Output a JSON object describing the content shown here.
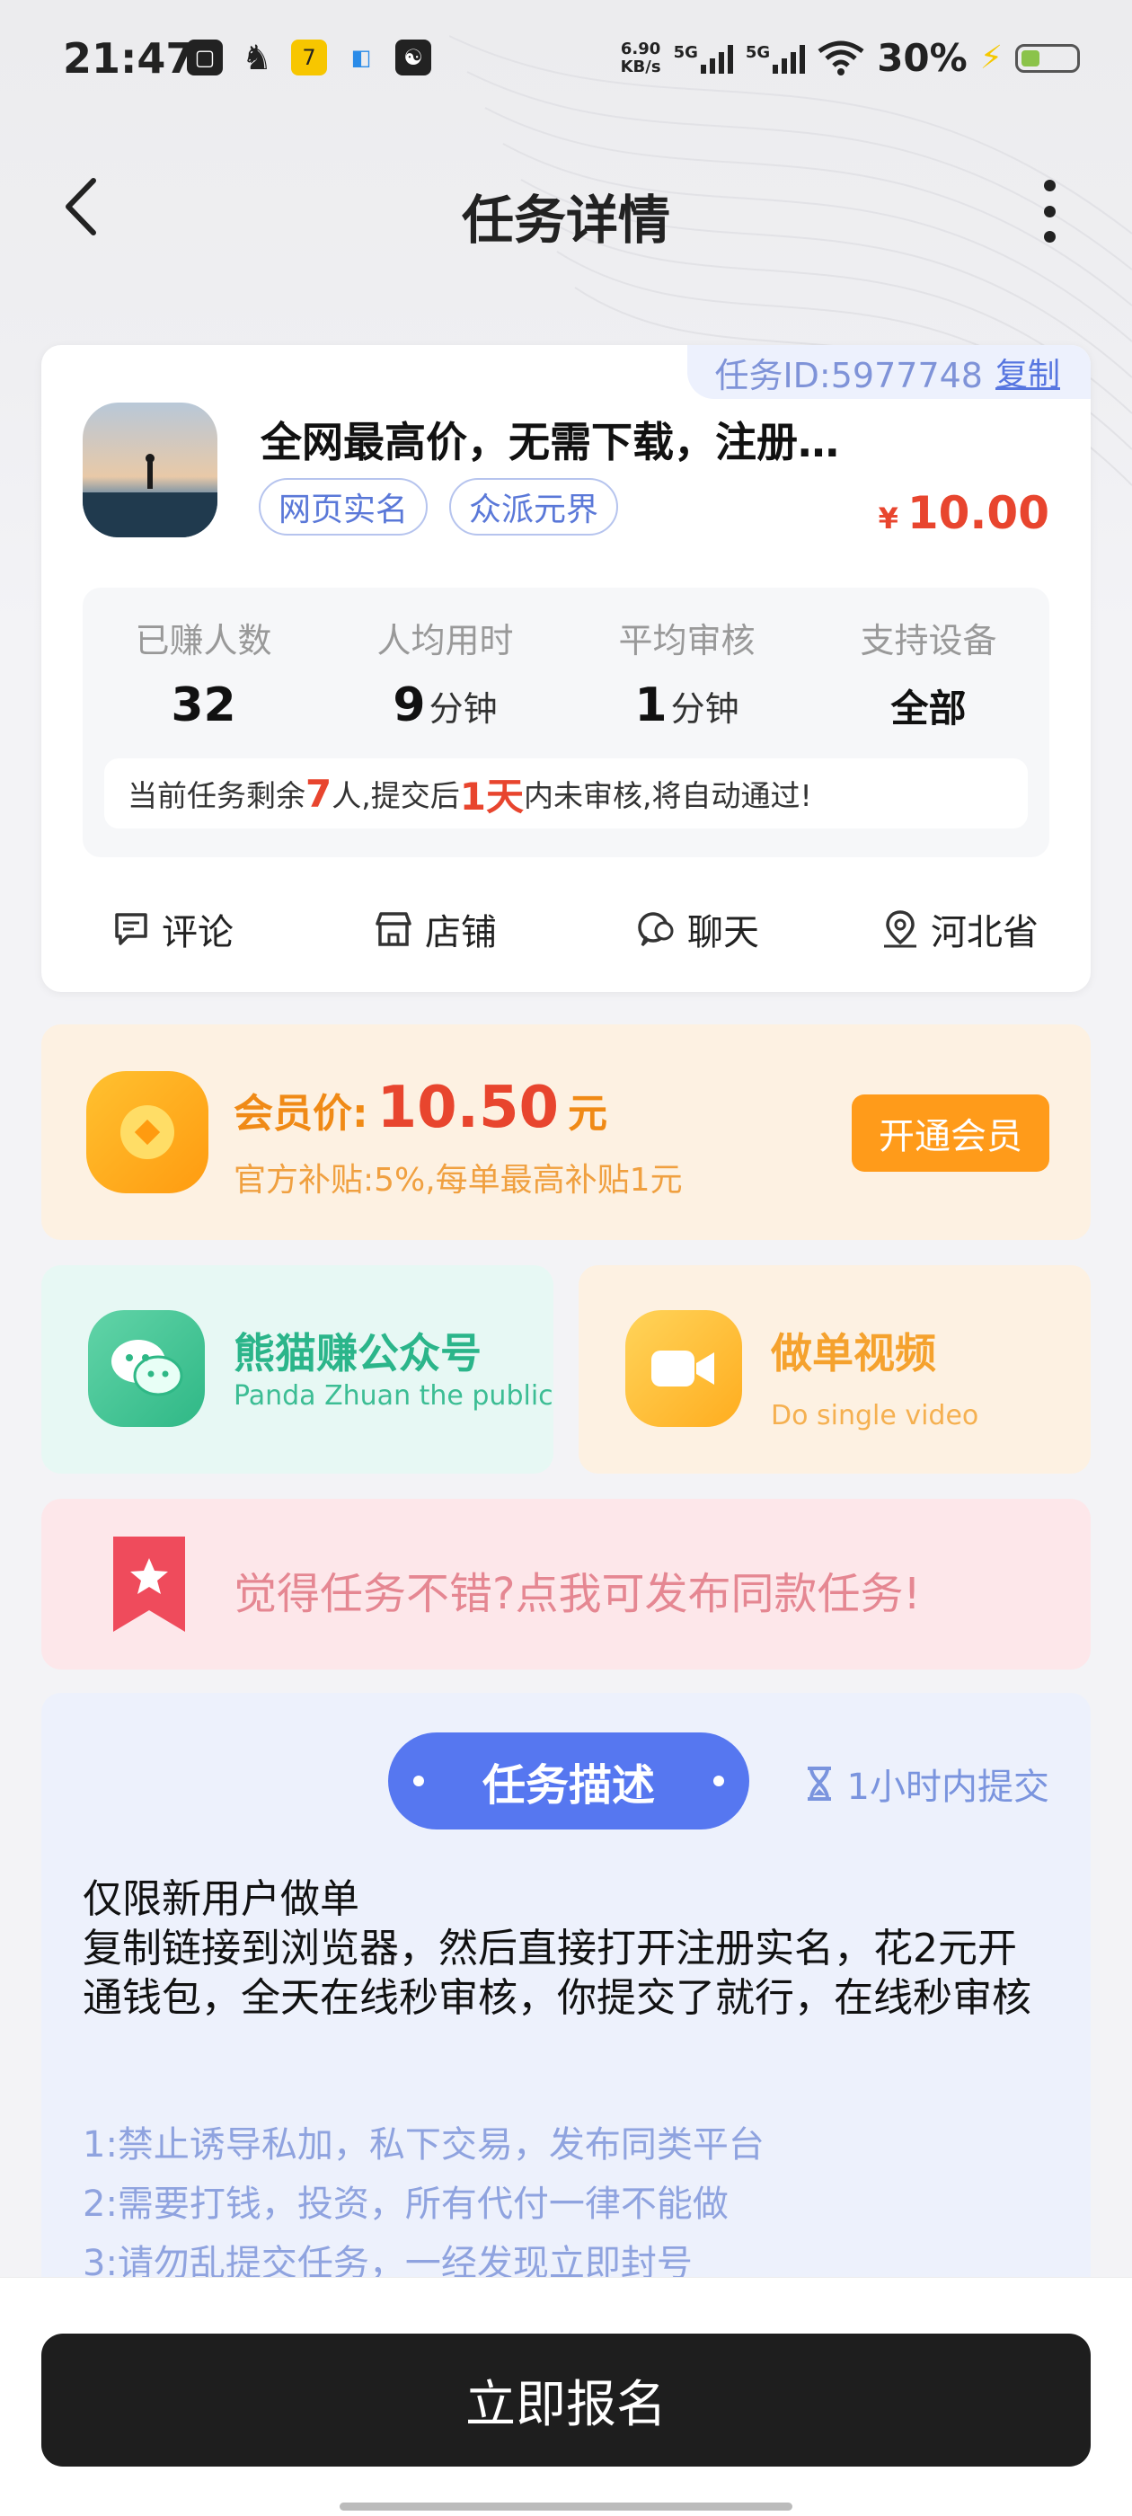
{
  "status_bar": {
    "time": "21:47",
    "left_icons": [
      "notification-icon",
      "qq-icon",
      "app-icon",
      "app-icon-2",
      "app-icon-3"
    ],
    "net_speed_value": "6.90",
    "net_speed_unit": "KB/s",
    "signal_1": "5G",
    "signal_2": "5G",
    "battery": "30%"
  },
  "nav": {
    "title": "任务详情"
  },
  "task": {
    "id_text": "任务ID:5977748",
    "copy_label": "复制",
    "title": "全网最高价，无需下载，注册…",
    "tags": [
      "网页实名",
      "众派元界"
    ],
    "price_currency": "¥",
    "price": "10.00",
    "stats": [
      {
        "label": "已赚人数",
        "value": "32",
        "unit": ""
      },
      {
        "label": "人均用时",
        "value": "9",
        "unit": "分钟"
      },
      {
        "label": "平均审核",
        "value": "1",
        "unit": "分钟"
      },
      {
        "label": "支持设备",
        "value": "全部",
        "unit": ""
      }
    ],
    "notice": {
      "part1": "当前任务剩余",
      "count": "7",
      "part2": "人,提交后",
      "days": "1天",
      "part3": "内未审核,将自动通过!"
    },
    "actions": [
      {
        "label": "评论",
        "icon": "comment-icon"
      },
      {
        "label": "店铺",
        "icon": "shop-icon"
      },
      {
        "label": "聊天",
        "icon": "chat-icon"
      },
      {
        "label": "河北省",
        "icon": "location-icon"
      }
    ]
  },
  "vip": {
    "label": "会员价:",
    "price": "10.50",
    "unit": "元",
    "subtitle": "官方补贴:5%,每单最高补贴1元",
    "button": "开通会员"
  },
  "promos": {
    "wechat": {
      "title": "熊猫赚公众号",
      "subtitle": "Panda Zhuan the public"
    },
    "video": {
      "title": "做单视频",
      "subtitle": "Do single video"
    }
  },
  "publish": {
    "text": "觉得任务不错?点我可发布同款任务!"
  },
  "description": {
    "pill": "任务描述",
    "deadline": "1小时内提交",
    "body": [
      "仅限新用户做单",
      "复制链接到浏览器，然后直接打开注册实名，花2元开通钱包，全天在线秒审核，你提交了就行，在线秒审核"
    ],
    "rules": [
      "1:禁止诱导私加，私下交易，发布同类平台",
      "2:需要打钱，投资，所有代付一律不能做",
      "3:请勿乱提交任务，一经发现立即封号"
    ]
  },
  "bottom": {
    "button": "立即报名"
  },
  "colors": {
    "accent_blue": "#5677f0",
    "price_red": "#e8452e",
    "vip_orange": "#ff9b1a",
    "wechat_green": "#2bb58a"
  }
}
